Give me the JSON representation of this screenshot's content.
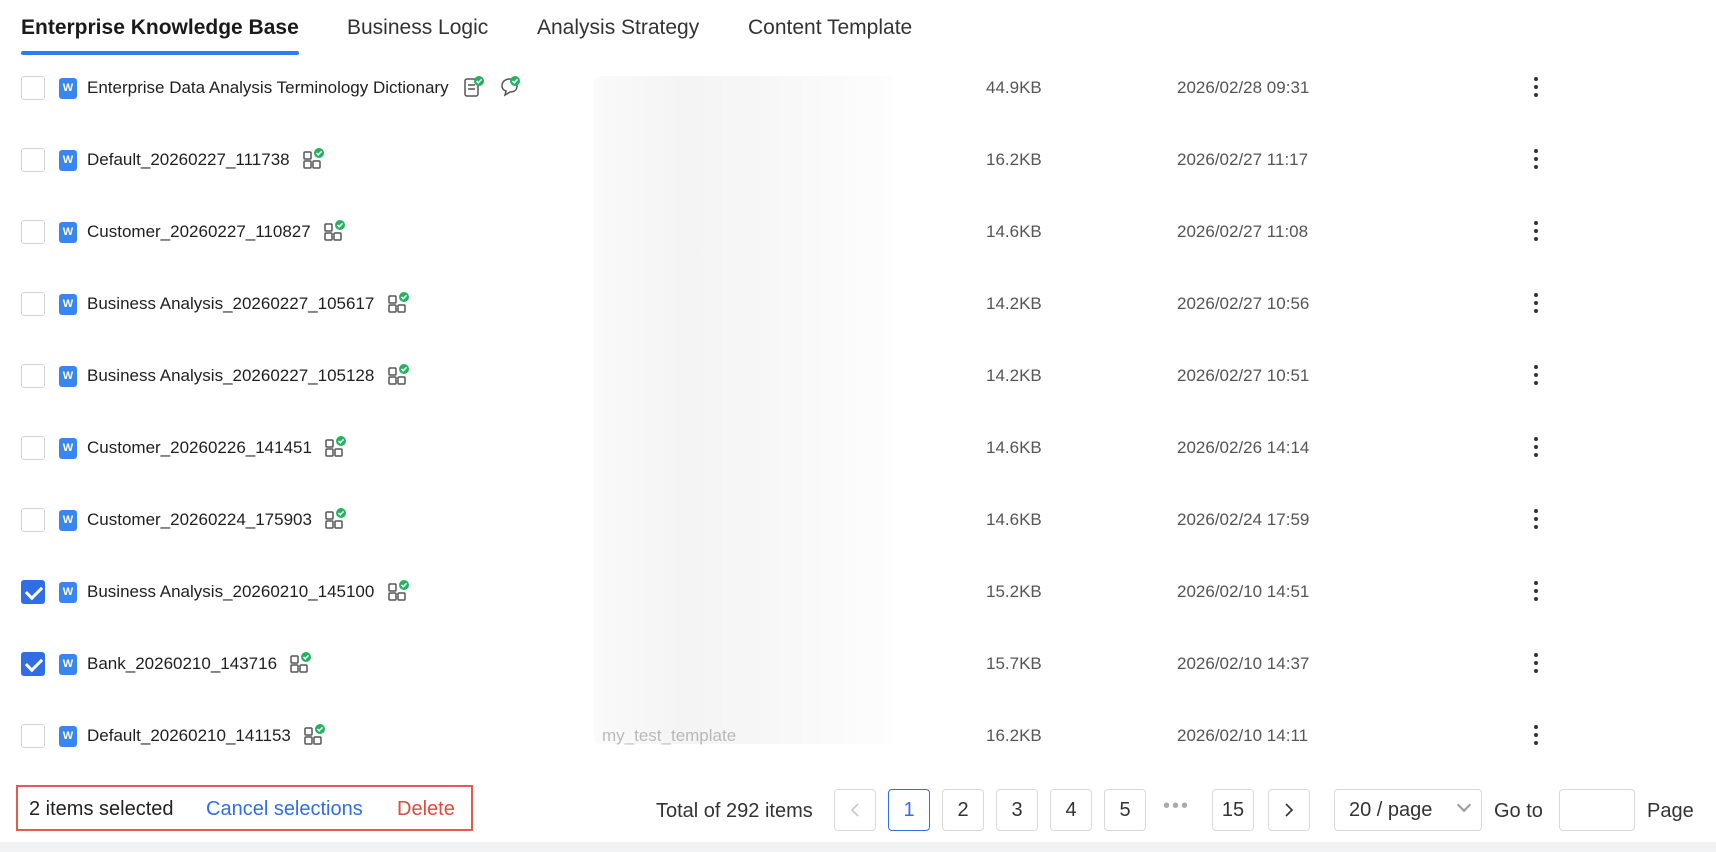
{
  "tabs": [
    "Enterprise Knowledge Base",
    "Business Logic",
    "Analysis Strategy",
    "Content Template"
  ],
  "active_tab": "Enterprise Knowledge Base",
  "doc_badge": "W",
  "rows": [
    {
      "name": "Enterprise Data Analysis Terminology Dictionary",
      "size": "44.9KB",
      "date": "2026/02/28 09:31",
      "checked": false,
      "status_icons": [
        "document-check-icon",
        "chat-check-icon"
      ]
    },
    {
      "name": "Default_20260227_111738",
      "size": "16.2KB",
      "date": "2026/02/27 11:17",
      "checked": false,
      "status_icons": [
        "grid-check-icon"
      ]
    },
    {
      "name": "Customer_20260227_110827",
      "size": "14.6KB",
      "date": "2026/02/27 11:08",
      "checked": false,
      "status_icons": [
        "grid-check-icon"
      ]
    },
    {
      "name": "Business Analysis_20260227_105617",
      "size": "14.2KB",
      "date": "2026/02/27 10:56",
      "checked": false,
      "status_icons": [
        "grid-check-icon"
      ]
    },
    {
      "name": "Business Analysis_20260227_105128",
      "size": "14.2KB",
      "date": "2026/02/27 10:51",
      "checked": false,
      "status_icons": [
        "grid-check-icon"
      ]
    },
    {
      "name": "Customer_20260226_141451",
      "size": "14.6KB",
      "date": "2026/02/26 14:14",
      "checked": false,
      "status_icons": [
        "grid-check-icon"
      ]
    },
    {
      "name": "Customer_20260224_175903",
      "size": "14.6KB",
      "date": "2026/02/24 17:59",
      "checked": false,
      "status_icons": [
        "grid-check-icon"
      ]
    },
    {
      "name": "Business Analysis_20260210_145100",
      "size": "15.2KB",
      "date": "2026/02/10 14:51",
      "checked": true,
      "status_icons": [
        "grid-check-icon"
      ]
    },
    {
      "name": "Bank_20260210_143716",
      "size": "15.7KB",
      "date": "2026/02/10 14:37",
      "checked": true,
      "status_icons": [
        "grid-check-icon"
      ]
    },
    {
      "name": "Default_20260210_141153",
      "size": "16.2KB",
      "date": "2026/02/10 14:11",
      "checked": false,
      "status_icons": [
        "grid-check-icon"
      ]
    }
  ],
  "obscured_text": "my_test_template",
  "selection": {
    "count_text": "2 items selected",
    "cancel_label": "Cancel selections",
    "delete_label": "Delete"
  },
  "pagination": {
    "total_text": "Total of 292 items",
    "pages": [
      "1",
      "2",
      "3",
      "4",
      "5",
      "15"
    ],
    "current": "1",
    "ellipsis": "•••",
    "page_size": "20 / page",
    "goto_label": "Go to",
    "page_label": "Page",
    "goto_value": ""
  },
  "colors": {
    "accent": "#2f6ee6",
    "danger": "#e04a3f",
    "success": "#22b35e",
    "highlight_box": "#e65a4f"
  }
}
